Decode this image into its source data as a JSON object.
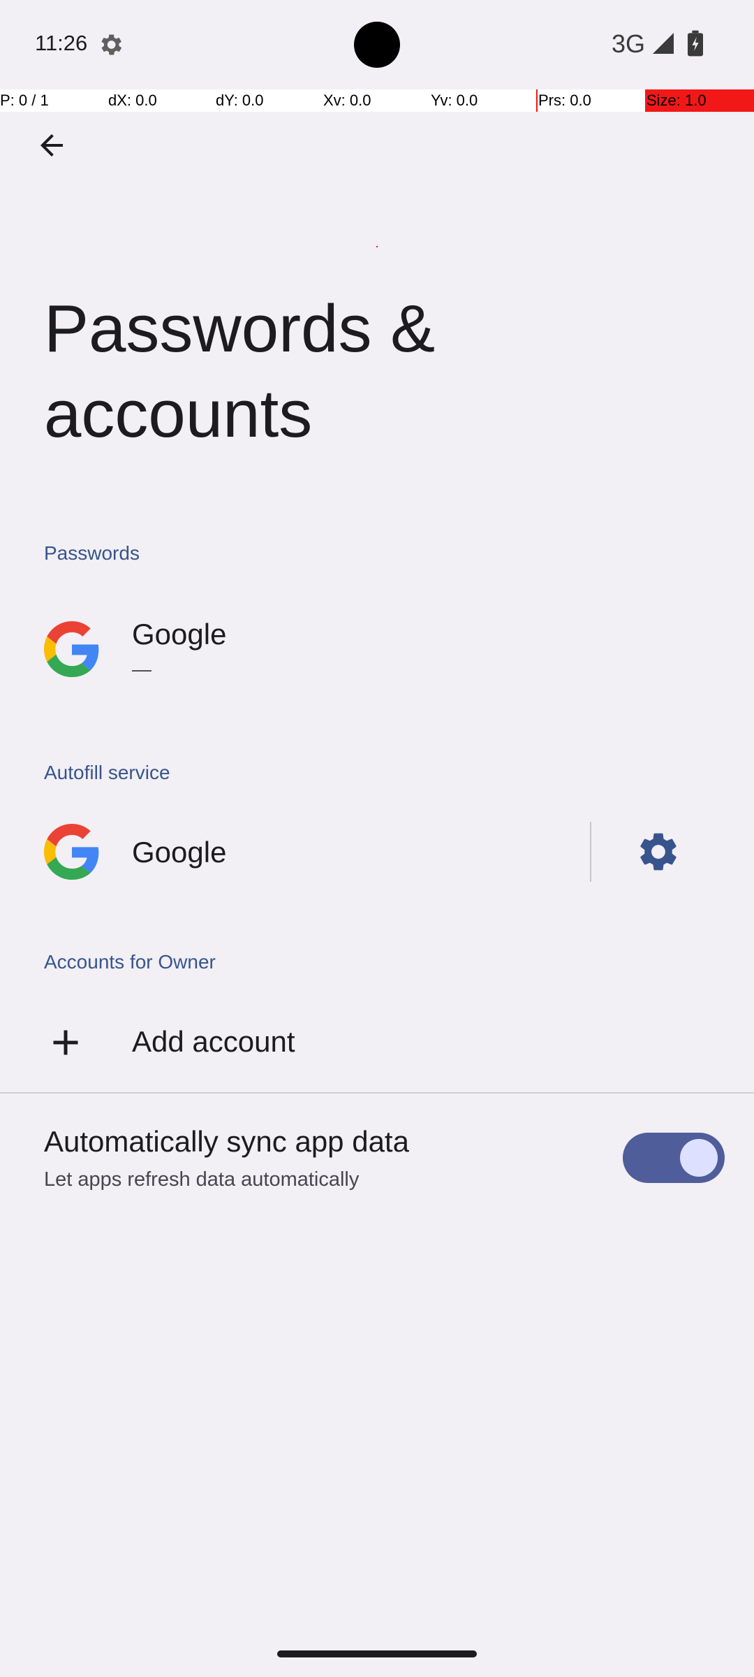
{
  "status_bar": {
    "time": "11:26",
    "network": "3G"
  },
  "overlay": {
    "p": "P: 0 / 1",
    "dx": "dX: 0.0",
    "dy": "dY: 0.0",
    "xv": "Xv: 0.0",
    "yv": "Yv: 0.0",
    "prs": "Prs: 0.0",
    "size": "Size: 1.0"
  },
  "page": {
    "title": "Passwords & accounts"
  },
  "passwords": {
    "header": "Passwords",
    "item_title": "Google",
    "item_subtitle": "—"
  },
  "autofill": {
    "header": "Autofill service",
    "item_title": "Google"
  },
  "accounts": {
    "header": "Accounts for Owner",
    "add_label": "Add account"
  },
  "sync": {
    "title": "Automatically sync app data",
    "subtitle": "Let apps refresh data automatically",
    "enabled": true
  },
  "colors": {
    "background": "#F2EFF5",
    "accent_header": "#37558C",
    "toggle_track": "#4F5D9A",
    "toggle_thumb": "#DDE1FF"
  }
}
